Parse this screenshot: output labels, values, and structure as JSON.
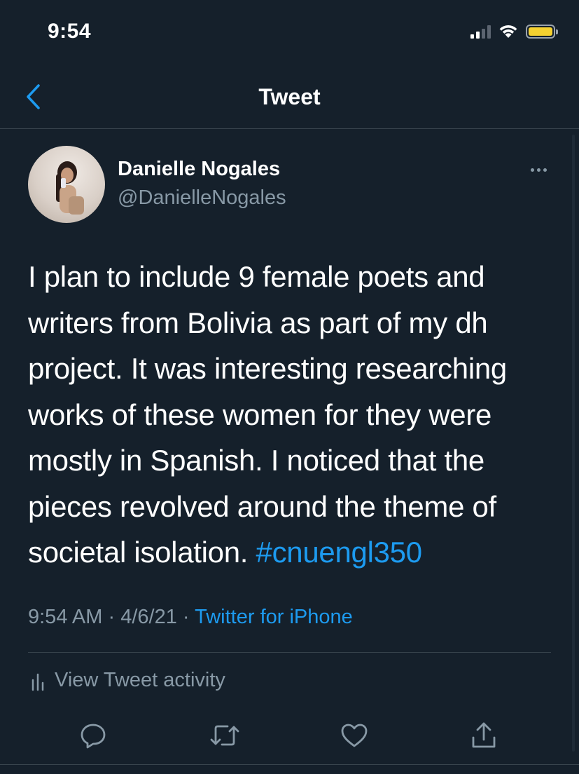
{
  "status_bar": {
    "time": "9:54"
  },
  "nav": {
    "title": "Tweet"
  },
  "tweet": {
    "author_name": "Danielle Nogales",
    "author_handle": "@DanielleNogales",
    "text": "I plan to include 9 female poets and writers from Bolivia as part of my dh project. It was interesting researching works of these women for they were mostly in Spanish. I noticed that the pieces revolved around the theme of societal isolation. ",
    "hashtag": "#cnuengl350",
    "time": "9:54 AM",
    "date": "4/6/21",
    "separator": "·",
    "source": "Twitter for iPhone",
    "activity_label": "View Tweet activity"
  },
  "colors": {
    "background": "#15202b",
    "accent": "#1d9bf0",
    "secondary_text": "#8899a6",
    "divider": "#38444d",
    "battery": "#f5d130"
  },
  "icons": {
    "back": "chevron-left-icon",
    "more": "more-horizontal-icon",
    "activity": "bar-chart-icon",
    "reply": "reply-icon",
    "retweet": "retweet-icon",
    "like": "heart-icon",
    "share": "share-icon"
  }
}
